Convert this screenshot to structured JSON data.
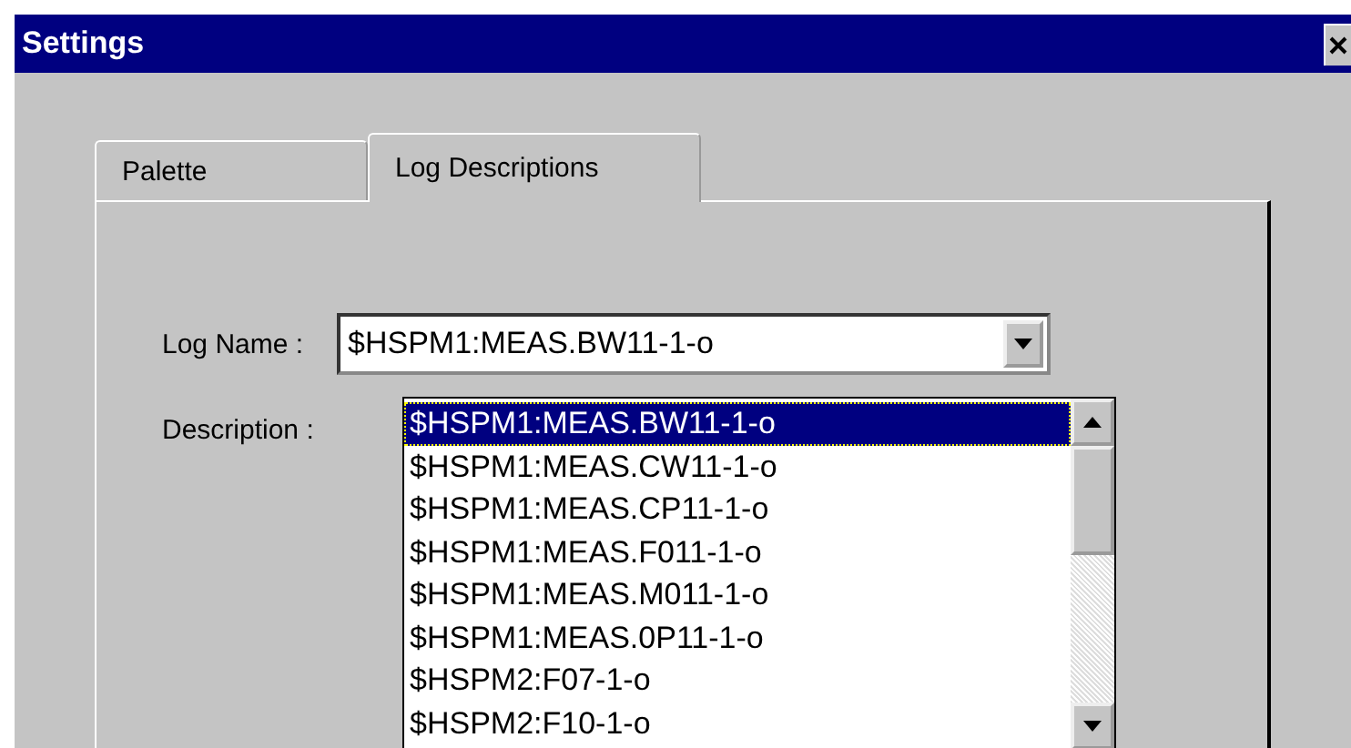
{
  "window": {
    "title": "Settings"
  },
  "tabs": [
    {
      "label": "Palette",
      "selected": false
    },
    {
      "label": "Log Descriptions",
      "selected": true
    }
  ],
  "log_name": {
    "label": "Log Name :",
    "value": "$HSPM1:MEAS.BW11-1-o"
  },
  "description": {
    "label": "Description :"
  },
  "dropdown_items": [
    {
      "text": "$HSPM1:MEAS.BW11-1-o",
      "selected": true
    },
    {
      "text": "$HSPM1:MEAS.CW11-1-o",
      "selected": false
    },
    {
      "text": "$HSPM1:MEAS.CP11-1-o",
      "selected": false
    },
    {
      "text": "$HSPM1:MEAS.F011-1-o",
      "selected": false
    },
    {
      "text": "$HSPM1:MEAS.M011-1-o",
      "selected": false
    },
    {
      "text": "$HSPM1:MEAS.0P11-1-o",
      "selected": false
    },
    {
      "text": "$HSPM2:F07-1-o",
      "selected": false
    },
    {
      "text": "$HSPM2:F10-1-o",
      "selected": false
    }
  ]
}
